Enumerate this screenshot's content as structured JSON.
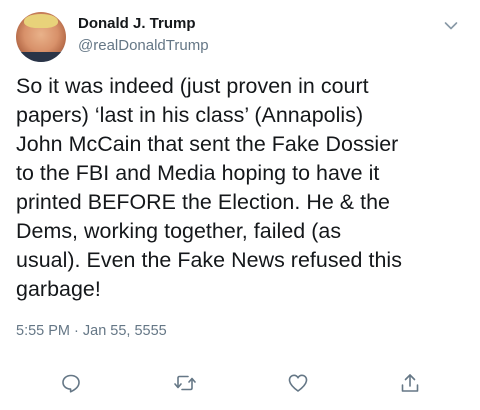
{
  "tweet": {
    "author_name": "Donald J. Trump",
    "author_handle": "@realDonaldTrump",
    "text": "So it was indeed (just proven in court\npapers) ‘last in his class’ (Annapolis)\nJohn McCain that sent the Fake Dossier\nto the FBI and Media hoping to have it\nprinted BEFORE the Election. He & the\nDems, working together, failed (as\nusual). Even the Fake News refused this\ngarbage!",
    "timestamp": "5:55 PM · Jan 55, 5555"
  },
  "icons": {
    "menu": "chevron-down-icon",
    "reply": "reply-icon",
    "retweet": "retweet-icon",
    "like": "heart-icon",
    "share": "share-icon"
  },
  "colors": {
    "text": "#14171a",
    "secondary": "#657786",
    "icon": "#657786",
    "background": "#ffffff"
  }
}
